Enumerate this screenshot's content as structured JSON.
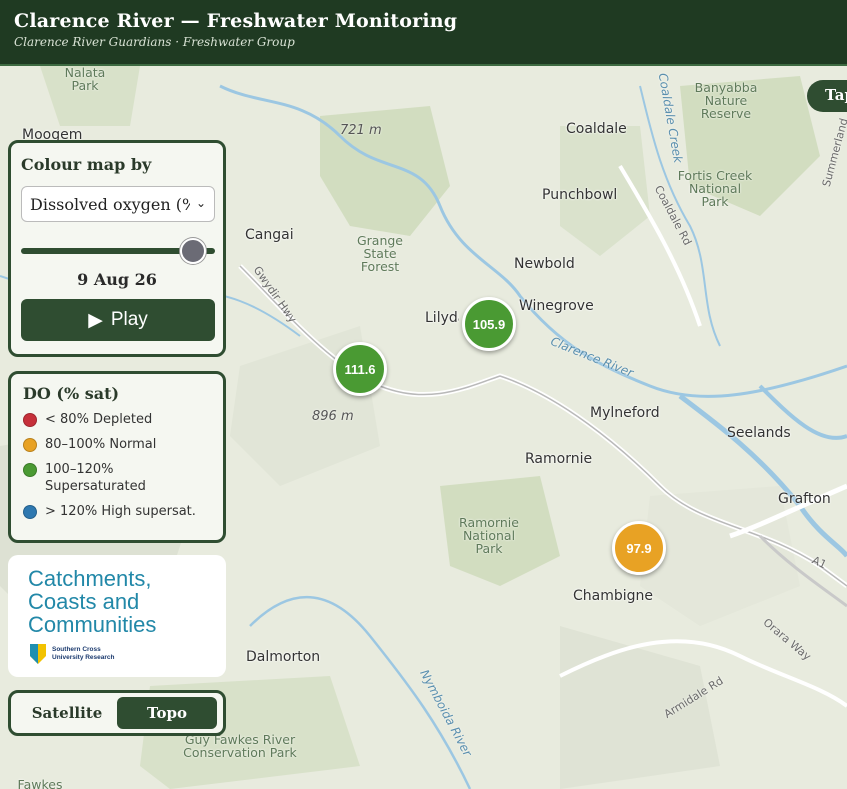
{
  "header": {
    "title": "Clarence River — Freshwater Monitoring",
    "subtitle": "Clarence River Guardians · Freshwater Group"
  },
  "controls": {
    "heading": "Colour map by",
    "select_value": "Dissolved oxygen (% sat)",
    "slider_fraction": 0.92,
    "date": "9 Aug 26",
    "play_label": "Play",
    "play_icon": "play-icon"
  },
  "legend": {
    "title": "DO (% sat)",
    "items": [
      {
        "label": "< 80% Depleted",
        "color": "#c6303a"
      },
      {
        "label": "80–100% Normal",
        "color": "#e8a224"
      },
      {
        "label": "100–120% Supersaturated",
        "color": "#4a9a33"
      },
      {
        "label": "> 120% High supersat.",
        "color": "#2e78b0"
      }
    ]
  },
  "logo": {
    "lines": [
      "Catchments,",
      "Coasts and",
      "Communities"
    ],
    "org_line1": "Southern Cross",
    "org_line2": "University Research"
  },
  "basemap_toggle": {
    "satellite": "Satellite",
    "topo": "Topo",
    "active": "Topo"
  },
  "right_tab": {
    "label": "Tap"
  },
  "markers": [
    {
      "value": "111.6",
      "color": "#4a9a33"
    },
    {
      "value": "105.9",
      "color": "#4a9a33"
    },
    {
      "value": "97.9",
      "color": "#e8a224"
    }
  ],
  "map_labels": {
    "places": [
      "Moogem",
      "Cangai",
      "Coaldale",
      "Punchbowl",
      "Newbold",
      "Lilydale",
      "Winegrove",
      "Mylneford",
      "Seelands",
      "Ramornie",
      "Grafton",
      "Chambigne",
      "Dalmorton"
    ],
    "parks": [
      "Nalata Park",
      "Banyabba Nature Reserve",
      "Fortis Creek National Park",
      "Grange State Forest",
      "Ramornie National Park",
      "Guy Fawkes River Conservation Park",
      "Fawkes"
    ],
    "elevations": [
      "721 m",
      "896 m"
    ],
    "roads": [
      "Gwydir Hwy",
      "Coaldale Rd",
      "Armidale Rd",
      "Orara Way",
      "A1",
      "Summerland"
    ],
    "rivers": [
      "Clarence River",
      "Nymboida River",
      "Coaldale Creek"
    ]
  }
}
